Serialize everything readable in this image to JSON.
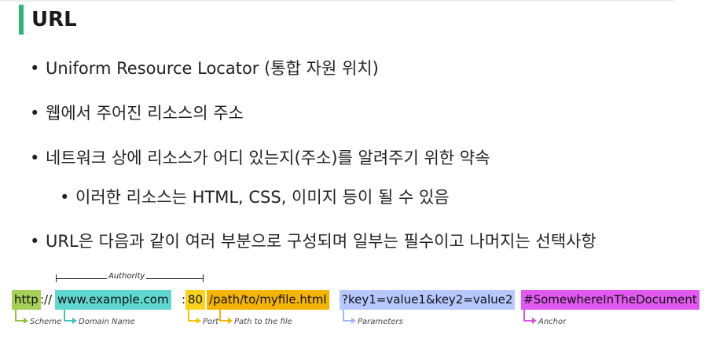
{
  "title": "URL",
  "bullets": [
    "Uniform Resource Locator (통합 자원 위치)",
    "웹에서 주어진 리소스의 주소",
    "네트워크 상에 리소스가 어디 있는지(주소)를 알려주기 위한 약속",
    "이러한 리소스는 HTML, CSS, 이미지 등이 될 수 있음",
    "URL은 다음과 같이 여러 부분으로 구성되며 일부는 필수이고 나머지는 선택사항"
  ],
  "url_parts": {
    "scheme": "http",
    "scheme_sep": "://",
    "domain": "www.example.com",
    "port_sep": ":",
    "port": "80",
    "path": "/path/to/myfile.html",
    "params": "?key1=value1&key2=value2",
    "anchor": "#SomewhereInTheDocument"
  },
  "labels": {
    "authority": "Authority",
    "scheme": "Scheme",
    "domain": "Domain Name",
    "port": "Port",
    "path": "Path to the file",
    "params": "Parameters",
    "anchor": "Anchor"
  },
  "colors": {
    "accent": "#2bb673",
    "scheme": "#a5d15a",
    "domain": "#5fd6cf",
    "port": "#f8d21b",
    "path": "#f4b400",
    "params": "#b6c8ff",
    "anchor": "#e159f0"
  }
}
